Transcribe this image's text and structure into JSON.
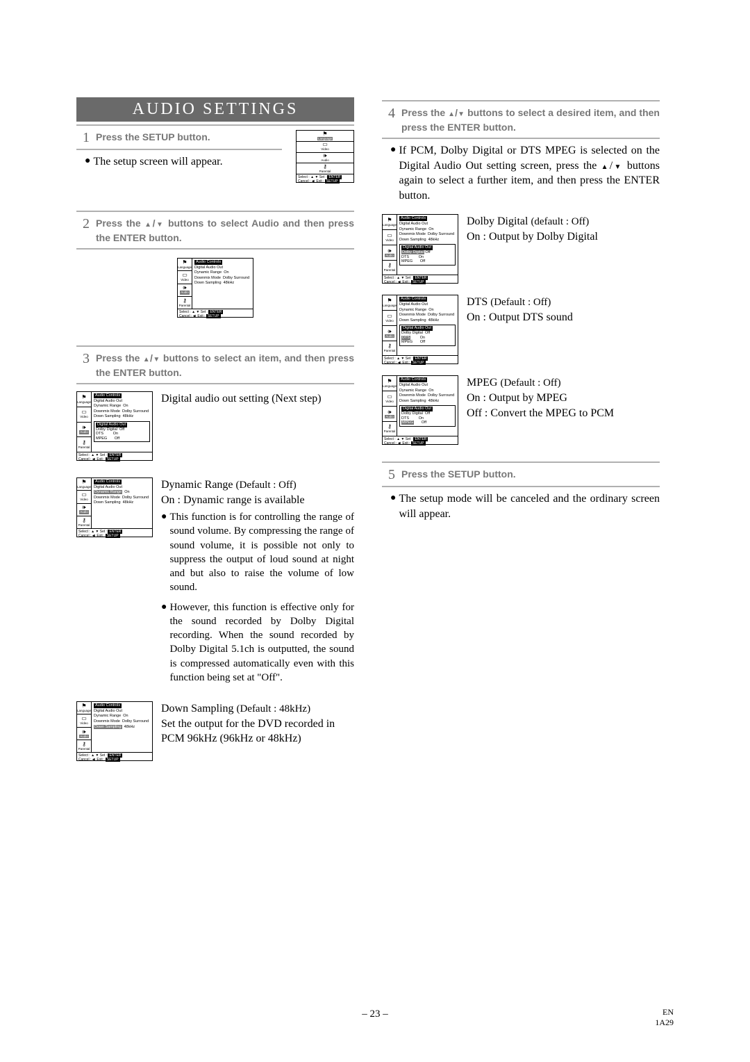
{
  "title": "AUDIO SETTINGS",
  "step1": {
    "num": "1",
    "head": "Press the SETUP button.",
    "body": "The setup screen will appear."
  },
  "step2": {
    "num": "2",
    "head_a": "Press the ",
    "head_b": " buttons to select Audio and then press the ENTER button."
  },
  "step3": {
    "num": "3",
    "head_a": "Press the ",
    "head_b": " buttons to select an item, and then press the ENTER button.",
    "digital_out": "Digital audio out setting (Next step)",
    "dyn_title_a": "Dynamic Range ",
    "dyn_title_b": "(Default : Off)",
    "dyn_on": "On : Dynamic range is available",
    "dyn_p1": "This function is for controlling the range of sound volume. By compressing the range of sound volume, it is possible not only to suppress the output of loud sound at night and but also to raise the volume of low sound.",
    "dyn_p2": "However, this function is effective only for the sound recorded by Dolby Digital recording. When the sound recorded by Dolby Digital 5.1ch is outputted, the sound is compressed automatically even with this function being set at \"Off\".",
    "down_a": "Down Sampling ",
    "down_b": "(Default : 48kHz)",
    "down_body": "Set the output for the DVD recorded in PCM 96kHz (96kHz or 48kHz)"
  },
  "step4": {
    "num": "4",
    "head_a": "Press the ",
    "head_b": " buttons to select a desired item, and then press the ENTER button.",
    "body_a": "If PCM, Dolby Digital or DTS MPEG is selected on the Digital Audio Out setting screen, press the ",
    "body_b": " buttons again to select a further item, and then press the ENTER button.",
    "dolby_a": "Dolby Digital ",
    "dolby_b": "(default : Off)",
    "dolby_on": "On : Output by Dolby Digital",
    "dts_a": "DTS ",
    "dts_b": "(Default : Off)",
    "dts_on": "On : Output DTS sound",
    "mpeg_a": "MPEG ",
    "mpeg_b": "(Default : Off)",
    "mpeg_on": "On : Output by MPEG",
    "mpeg_off": "Off : Convert the MPEG to PCM"
  },
  "step5": {
    "num": "5",
    "head": "Press the SETUP button.",
    "body": "The setup mode will be canceled and the ordinary screen will appear."
  },
  "screens": {
    "title": "Audio Controls",
    "digital_audio_out": "Digital Audio Out",
    "dyn_range": "Dynamic Range",
    "dyn_range_on": "On",
    "downmix": "Downmix Mode",
    "downmix_val": "Dolby Surround",
    "downsamp": "Down Sampling",
    "downsamp_val": "48kHz",
    "dolby_digital": "Dolby Digital",
    "dts": "DTS",
    "mpeg": "MPEG",
    "on": "On",
    "off": "Off",
    "tabs": {
      "lang": "Language",
      "video": "Video",
      "audio": "Audio",
      "parental": "Parental"
    },
    "select": "Select :",
    "set": "Set :",
    "enter": "ENTER",
    "cancel": "Cancel :",
    "exit": "Exit :",
    "setup": "SETUP",
    "ret": "◀"
  },
  "page_num": "– 23 –",
  "footer_en": "EN",
  "footer_code": "1A29"
}
